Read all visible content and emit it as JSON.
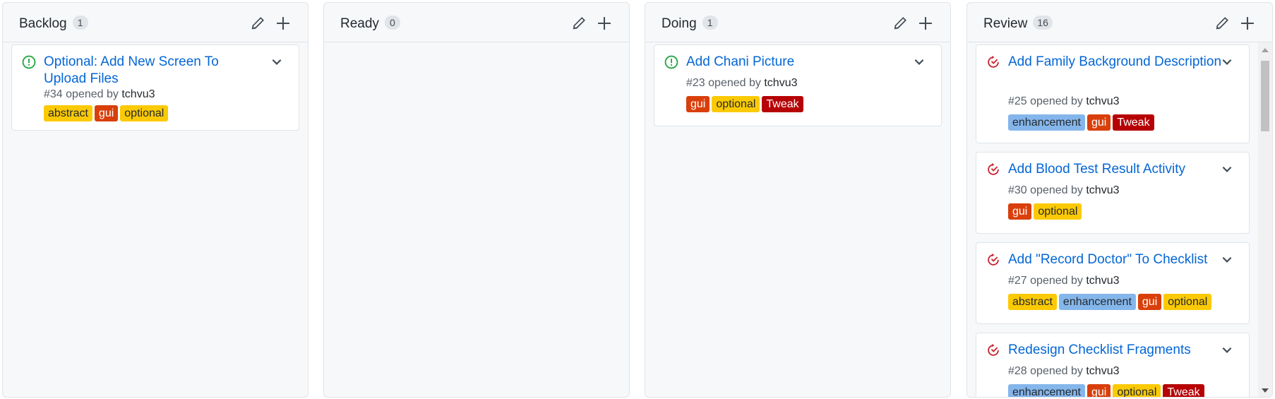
{
  "colors": {
    "open_icon": "#28a745",
    "closed_icon": "#cb2431",
    "title_link": "#0366d6"
  },
  "columns": [
    {
      "name": "Backlog",
      "count": "1",
      "cards": [
        {
          "title": "Optional: Add New Screen To Upload Files",
          "number": "#34",
          "opened_by": "opened by",
          "author": "tchvu3",
          "icon": "issue-opened-icon",
          "labels": [
            {
              "text": "abstract",
              "bg": "#fbca04",
              "fg": "#24292e"
            },
            {
              "text": "gui",
              "bg": "#d93f0b",
              "fg": "#ffffff"
            },
            {
              "text": "optional",
              "bg": "#fbca04",
              "fg": "#24292e"
            }
          ]
        }
      ]
    },
    {
      "name": "Ready",
      "count": "0",
      "cards": []
    },
    {
      "name": "Doing",
      "count": "1",
      "cards": [
        {
          "title": "Add Chani Picture",
          "number": "#23",
          "opened_by": "opened by",
          "author": "tchvu3",
          "icon": "issue-opened-icon",
          "labels": [
            {
              "text": "gui",
              "bg": "#d93f0b",
              "fg": "#ffffff"
            },
            {
              "text": "optional",
              "bg": "#fbca04",
              "fg": "#24292e"
            },
            {
              "text": "Tweak",
              "bg": "#b60205",
              "fg": "#ffffff"
            }
          ]
        }
      ]
    },
    {
      "name": "Review",
      "count": "16",
      "cards": [
        {
          "title": "Add Family Background Description",
          "number": "#25",
          "opened_by": "opened by",
          "author": "tchvu3",
          "icon": "issue-reopened-icon",
          "labels": [
            {
              "text": "enhancement",
              "bg": "#84b6eb",
              "fg": "#24292e"
            },
            {
              "text": "gui",
              "bg": "#d93f0b",
              "fg": "#ffffff"
            },
            {
              "text": "Tweak",
              "bg": "#b60205",
              "fg": "#ffffff"
            }
          ]
        },
        {
          "title": "Add Blood Test Result Activity",
          "number": "#30",
          "opened_by": "opened by",
          "author": "tchvu3",
          "icon": "issue-reopened-icon",
          "labels": [
            {
              "text": "gui",
              "bg": "#d93f0b",
              "fg": "#ffffff"
            },
            {
              "text": "optional",
              "bg": "#fbca04",
              "fg": "#24292e"
            }
          ]
        },
        {
          "title": "Add \"Record Doctor\" To Checklist",
          "number": "#27",
          "opened_by": "opened by",
          "author": "tchvu3",
          "icon": "issue-reopened-icon",
          "labels": [
            {
              "text": "abstract",
              "bg": "#fbca04",
              "fg": "#24292e"
            },
            {
              "text": "enhancement",
              "bg": "#84b6eb",
              "fg": "#24292e"
            },
            {
              "text": "gui",
              "bg": "#d93f0b",
              "fg": "#ffffff"
            },
            {
              "text": "optional",
              "bg": "#fbca04",
              "fg": "#24292e"
            }
          ]
        },
        {
          "title": "Redesign Checklist Fragments",
          "number": "#28",
          "opened_by": "opened by",
          "author": "tchvu3",
          "icon": "issue-reopened-icon",
          "labels": [
            {
              "text": "enhancement",
              "bg": "#84b6eb",
              "fg": "#24292e"
            },
            {
              "text": "gui",
              "bg": "#d93f0b",
              "fg": "#ffffff"
            },
            {
              "text": "optional",
              "bg": "#fbca04",
              "fg": "#24292e"
            },
            {
              "text": "Tweak",
              "bg": "#b60205",
              "fg": "#ffffff"
            }
          ]
        }
      ]
    }
  ]
}
